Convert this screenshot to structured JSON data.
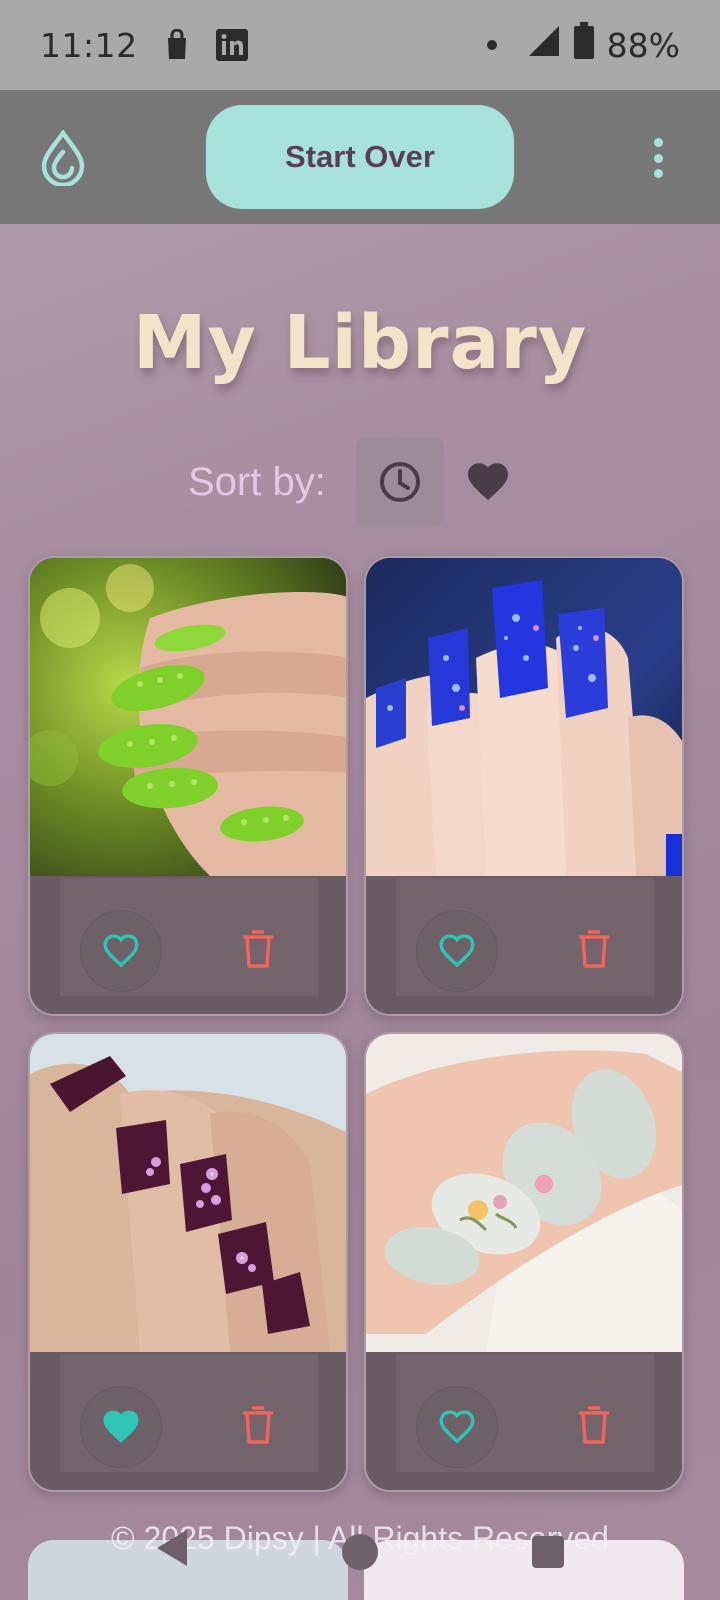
{
  "status_bar": {
    "time": "11:12",
    "battery_percent": "88%",
    "icons": [
      "shopping-bag-icon",
      "linkedin-icon",
      "notification-dot-icon",
      "signal-icon",
      "battery-icon"
    ]
  },
  "app_bar": {
    "logo_icon": "droplet-logo-icon",
    "start_over_label": "Start Over",
    "menu_icon": "kebab-menu-icon"
  },
  "page": {
    "title": "My Library",
    "sort_label": "Sort by:",
    "sort_options": [
      {
        "icon": "clock-icon",
        "selected": true
      },
      {
        "icon": "heart-icon",
        "selected": false
      }
    ]
  },
  "library": {
    "items": [
      {
        "image": "green textured glitter nails photo",
        "favorited": false
      },
      {
        "image": "blue glitter coffin nails photo",
        "favorited": false
      },
      {
        "image": "plum nails with pink floral art photo",
        "favorited": true
      },
      {
        "image": "pale sage nails with floral accent photo",
        "favorited": false
      }
    ]
  },
  "footer": {
    "copyright": "© 2025 Dipsy | All Rights Reserved"
  },
  "colors": {
    "accent_teal": "#2ec4b6",
    "delete_red": "#f0645a",
    "button_bg": "#a7e3dc",
    "title_cream": "#f3e3c9",
    "sort_label": "#e7c6ea"
  }
}
